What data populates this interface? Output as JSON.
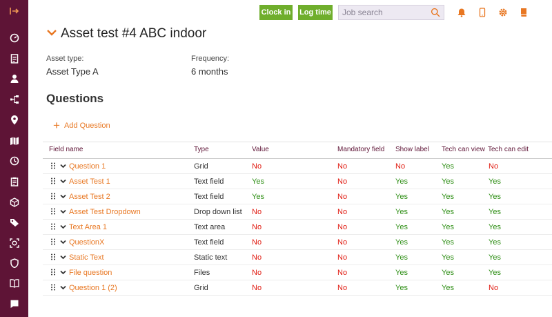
{
  "colors": {
    "sidebar_bg": "#5e1436",
    "accent_orange": "#e87722",
    "button_green": "#6fae2c",
    "header_purple": "#5e1436",
    "yes_green": "#2f8f16",
    "no_red": "#e0190f"
  },
  "sidebar": {
    "icons": [
      "expand-sidebar-icon",
      "dashboard-icon",
      "quotes-icon",
      "customers-icon",
      "hierarchy-icon",
      "location-icon",
      "map-icon",
      "clock-icon",
      "jobs-icon",
      "box-icon",
      "tags-icon",
      "assets-icon",
      "shield-icon",
      "book-icon",
      "chat-icon"
    ]
  },
  "topbar": {
    "clock_in_label": "Clock in",
    "log_time_label": "Log time",
    "search_placeholder": "Job search",
    "icons": [
      "bell-icon",
      "phone-icon",
      "gear-icon",
      "book-icon"
    ]
  },
  "page": {
    "title": "Asset test #4 ABC indoor",
    "asset_type_label": "Asset type:",
    "asset_type_value": "Asset Type A",
    "frequency_label": "Frequency:",
    "frequency_value": "6 months"
  },
  "questions": {
    "section_title": "Questions",
    "add_label": "Add Question",
    "headers": {
      "field_name": "Field name",
      "type": "Type",
      "value": "Value",
      "mandatory": "Mandatory field",
      "show_label": "Show label",
      "tech_view": "Tech can view",
      "tech_edit": "Tech can edit"
    },
    "rows": [
      {
        "name": "Question 1",
        "type": "Grid",
        "value": "No",
        "mandatory": "No",
        "show_label": "No",
        "tech_view": "Yes",
        "tech_edit": "No"
      },
      {
        "name": "Asset Test 1",
        "type": "Text field",
        "value": "Yes",
        "mandatory": "No",
        "show_label": "Yes",
        "tech_view": "Yes",
        "tech_edit": "Yes"
      },
      {
        "name": "Asset Test 2",
        "type": "Text field",
        "value": "Yes",
        "mandatory": "No",
        "show_label": "Yes",
        "tech_view": "Yes",
        "tech_edit": "Yes"
      },
      {
        "name": "Asset Test Dropdown",
        "type": "Drop down list",
        "value": "No",
        "mandatory": "No",
        "show_label": "Yes",
        "tech_view": "Yes",
        "tech_edit": "Yes"
      },
      {
        "name": "Text Area 1",
        "type": "Text area",
        "value": "No",
        "mandatory": "No",
        "show_label": "Yes",
        "tech_view": "Yes",
        "tech_edit": "Yes"
      },
      {
        "name": "QuestionX",
        "type": "Text field",
        "value": "No",
        "mandatory": "No",
        "show_label": "Yes",
        "tech_view": "Yes",
        "tech_edit": "Yes"
      },
      {
        "name": "Static Text",
        "type": "Static text",
        "value": "No",
        "mandatory": "No",
        "show_label": "Yes",
        "tech_view": "Yes",
        "tech_edit": "Yes"
      },
      {
        "name": "File question",
        "type": "Files",
        "value": "No",
        "mandatory": "No",
        "show_label": "Yes",
        "tech_view": "Yes",
        "tech_edit": "Yes"
      },
      {
        "name": "Question 1 (2)",
        "type": "Grid",
        "value": "No",
        "mandatory": "No",
        "show_label": "Yes",
        "tech_view": "Yes",
        "tech_edit": "No"
      }
    ]
  }
}
